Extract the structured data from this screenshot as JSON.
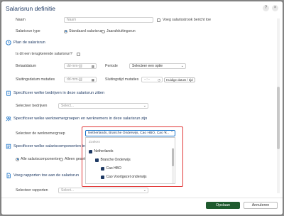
{
  "dialog": {
    "title": "Salarisrun definitie"
  },
  "header": {
    "help_label": "?",
    "close_label": "×"
  },
  "general": {
    "name_label": "Naam",
    "name_placeholder": "Naam",
    "show_checkbox_label": "Voeg salarisstrook bericht toe",
    "type_label": "Salarisrun type",
    "type_options": [
      "Standaard salarisrun",
      "Jaarafsluitingsrun"
    ],
    "type_selected": "Standaard salarisrun"
  },
  "plan": {
    "section_title": "Plan de salarisrun",
    "recurring_question": "Is dit een terugkerende salarisrun?",
    "paydate_label": "Betaaldatum",
    "paydate_placeholder": "dd-mm-jjjj",
    "period_label": "Periode",
    "period_placeholder": "Selecteer een optie",
    "closing_date_label": "Sluitingsdatum mutaties",
    "closing_date_placeholder": "dd-mm-jjjj",
    "closing_time_label": "Sluitingstijd mutaties",
    "closing_time_placeholder": "--:--",
    "closing_time_button": "Huidige datum / tijd"
  },
  "companies": {
    "section_title": "Specificeer welke bedrijven in deze salarisrun zitten",
    "select_label": "Selecteer bedrijven",
    "select_placeholder": "Select..."
  },
  "groups": {
    "section_title": "Specificeer welke werknemergroepen en werknemers in deze salarisrun zijn",
    "select_label": "Selecteer de werknemergroep",
    "selected_value": "Netherlands, Branche Onderwijs, Cao HBO, Cao V...",
    "search_placeholder": "Zoeken",
    "options": [
      {
        "label": "Netherlands",
        "checked": true,
        "level": 0
      },
      {
        "label": "Branche Onderwijs",
        "checked": true,
        "level": 1
      },
      {
        "label": "Cao HBO",
        "checked": true,
        "level": 2
      },
      {
        "label": "Cao Voortgezet onderwijs",
        "checked": true,
        "level": 2
      }
    ]
  },
  "components": {
    "section_title": "Specificeer welke salariscomponenten in deze s",
    "radio_options": [
      "Alle salariscomponenten",
      "Alleen gesele"
    ],
    "radio_selected": "Alle salariscomponenten"
  },
  "reports": {
    "section_title": "Voeg rapporten toe aan de salarisrun",
    "select_label": "Selecteer rapporten",
    "select_placeholder": "Select..."
  },
  "footer": {
    "primary_label": "Opslaan",
    "secondary_label": "Annuleren"
  },
  "colors": {
    "accent": "#1f3a64",
    "primary_button": "#1f5a2e",
    "highlight": "#e23a3a",
    "focus": "#1a73c8"
  }
}
